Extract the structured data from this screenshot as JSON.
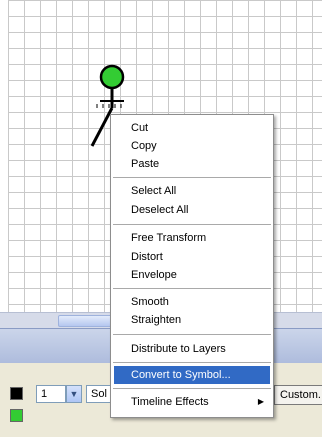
{
  "context_menu": {
    "items": [
      {
        "label": "Cut"
      },
      {
        "label": "Copy"
      },
      {
        "label": "Paste"
      },
      {
        "label": "Select All"
      },
      {
        "label": "Deselect All"
      },
      {
        "label": "Free Transform"
      },
      {
        "label": "Distort"
      },
      {
        "label": "Envelope"
      },
      {
        "label": "Smooth"
      },
      {
        "label": "Straighten"
      },
      {
        "label": "Distribute to Layers"
      },
      {
        "label": "Convert to Symbol..."
      },
      {
        "label": "Timeline Effects"
      }
    ],
    "highlighted": "Convert to Symbol...",
    "submenu_arrow_icon": "triangle-right-icon"
  },
  "properties": {
    "stroke_size": "1",
    "stroke_style": "Sol",
    "custom_button": "Custom..."
  },
  "colors": {
    "figure_head": "#33cc33",
    "menu_highlight": "#316ac5",
    "fill_swatch": "#33cc33"
  }
}
